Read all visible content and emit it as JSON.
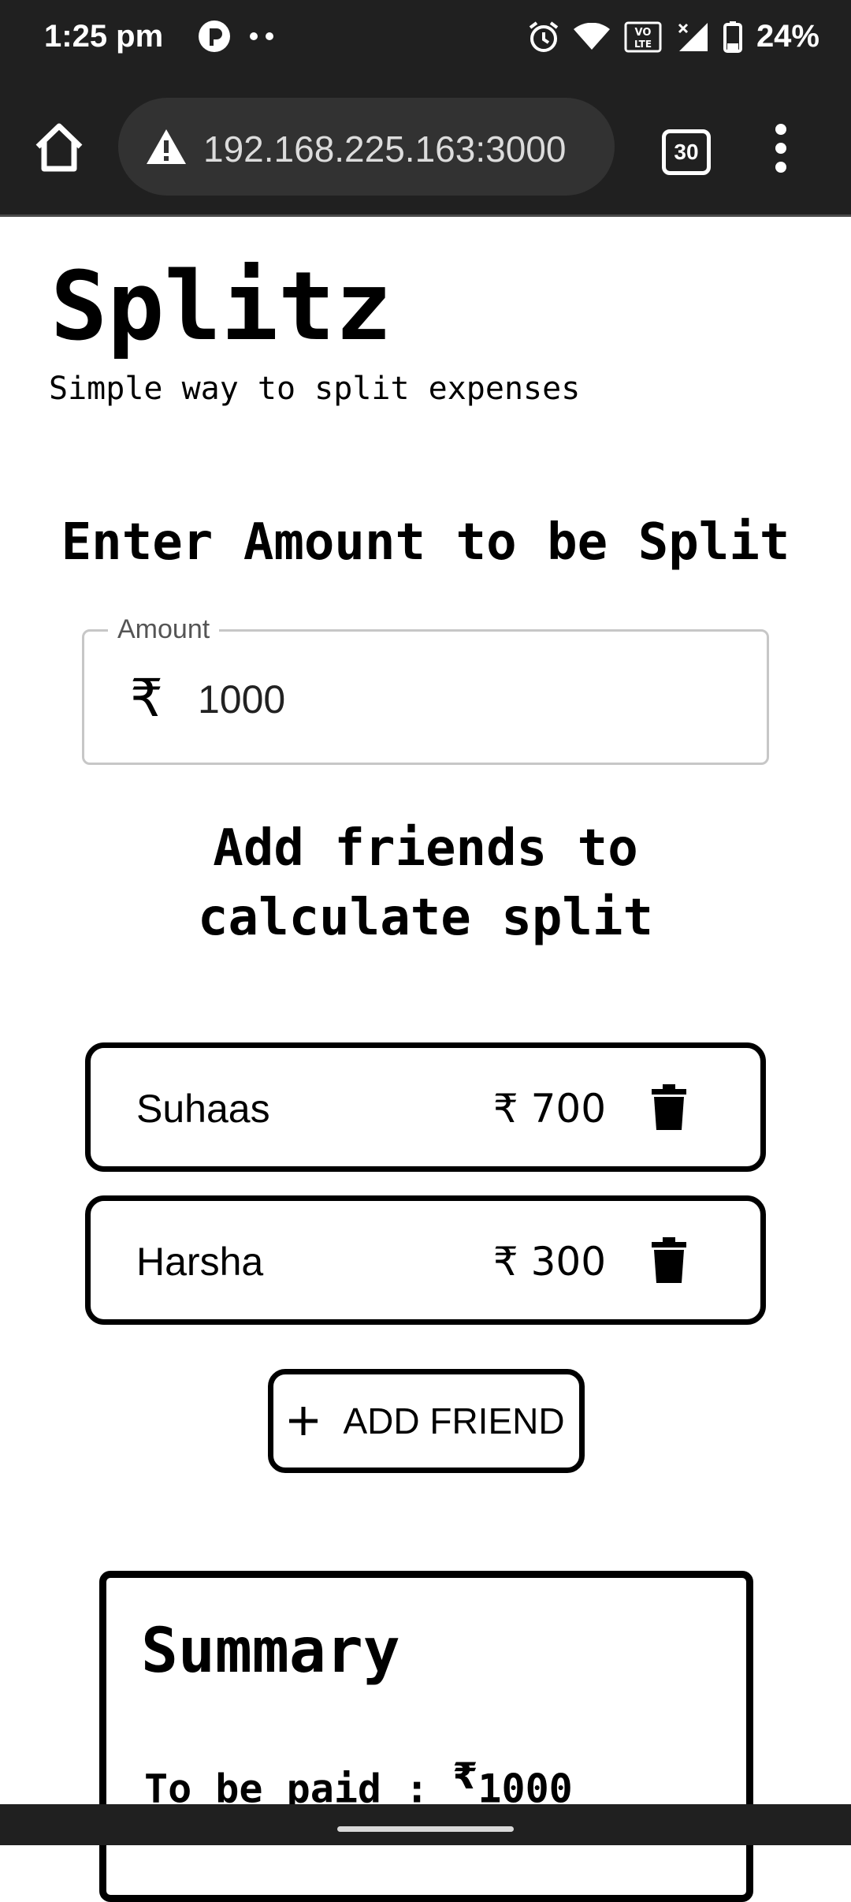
{
  "status_bar": {
    "time": "1:25 pm",
    "battery_percent": "24%",
    "network_label": "VO LTE"
  },
  "browser": {
    "url": "192.168.225.163:3000",
    "tab_count": "30"
  },
  "app": {
    "title": "Splitz",
    "subtitle": "Simple way to split expenses"
  },
  "amount_section": {
    "heading": "Enter Amount to be Split",
    "field_label": "Amount",
    "currency_symbol": "₹",
    "value": "1000"
  },
  "friends_section": {
    "heading": "Add friends to calculate split",
    "friends": [
      {
        "name": "Suhaas",
        "amount": "₹ 700"
      },
      {
        "name": "Harsha",
        "amount": "₹ 300"
      }
    ],
    "add_button_label": "ADD FRIEND"
  },
  "summary": {
    "title": "Summary",
    "to_be_paid_label": "To be paid :",
    "currency_symbol": "₹",
    "to_be_paid_value": "1000"
  },
  "colors": {
    "system_bar_bg": "#202020",
    "url_pill_bg": "#323232",
    "page_bg": "#ffffff",
    "text": "#000000"
  }
}
